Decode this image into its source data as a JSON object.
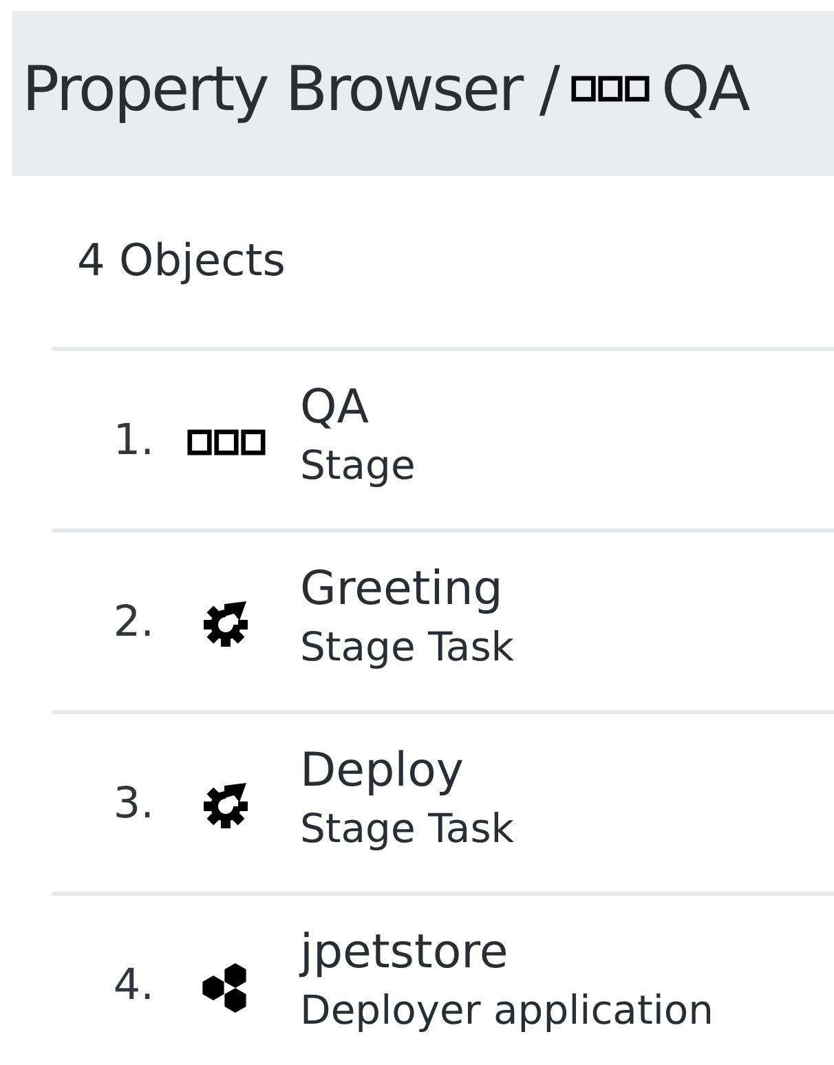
{
  "header": {
    "title": "Property Browser /",
    "kind": "stage",
    "name": "QA"
  },
  "count": "4 Objects",
  "objects": [
    {
      "number": "1.",
      "kind": "stage",
      "name": "QA",
      "type": "Stage"
    },
    {
      "number": "2.",
      "kind": "task",
      "name": "Greeting",
      "type": "Stage Task"
    },
    {
      "number": "3.",
      "kind": "task",
      "name": "Deploy",
      "type": "Stage Task"
    },
    {
      "number": "4.",
      "kind": "application",
      "name": "jpetstore",
      "type": "Deployer application"
    }
  ]
}
